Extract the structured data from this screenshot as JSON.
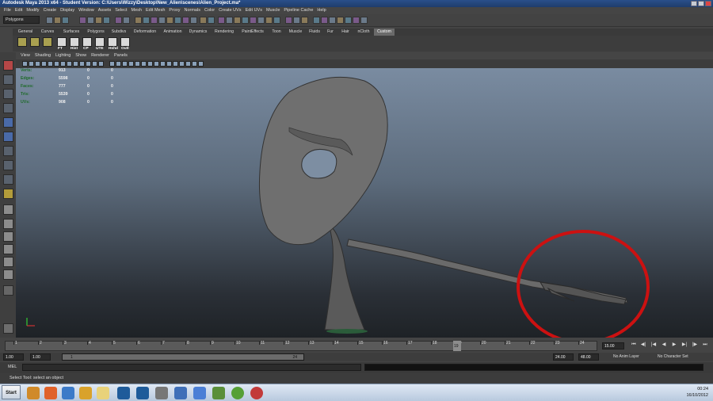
{
  "window": {
    "title": "Autodesk Maya 2013 x64 - Student Version: C:\\Users\\Wizzy\\Desktop\\New_Alien\\scenes\\Alien_Project.ma*"
  },
  "menubar": [
    "File",
    "Edit",
    "Modify",
    "Create",
    "Display",
    "Window",
    "Assets",
    "Select",
    "Mesh",
    "Edit Mesh",
    "Proxy",
    "Normals",
    "Color",
    "Create UVs",
    "Edit UVs",
    "Muscle",
    "Pipeline Cache",
    "Help"
  ],
  "status_line": {
    "mode": "Polygons"
  },
  "shelf_tabs": [
    {
      "label": "General",
      "active": false
    },
    {
      "label": "Curves",
      "active": false
    },
    {
      "label": "Surfaces",
      "active": false
    },
    {
      "label": "Polygons",
      "active": false
    },
    {
      "label": "Subdivs",
      "active": false
    },
    {
      "label": "Deformation",
      "active": false
    },
    {
      "label": "Animation",
      "active": false
    },
    {
      "label": "Dynamics",
      "active": false
    },
    {
      "label": "Rendering",
      "active": false
    },
    {
      "label": "PaintEffects",
      "active": false
    },
    {
      "label": "Toon",
      "active": false
    },
    {
      "label": "Muscle",
      "active": false
    },
    {
      "label": "Fluids",
      "active": false
    },
    {
      "label": "Fur",
      "active": false
    },
    {
      "label": "Hair",
      "active": false
    },
    {
      "label": "nCloth",
      "active": false
    },
    {
      "label": "Custom",
      "active": true
    }
  ],
  "shelf_buttons": [
    "FT",
    "Hist",
    "CP",
    "UTE",
    "Hshd",
    "Outl"
  ],
  "viewport": {
    "menu": [
      "View",
      "Shading",
      "Lighting",
      "Show",
      "Renderer",
      "Panels"
    ],
    "hud": [
      {
        "label": "Verts:",
        "v1": "913",
        "v2": "0",
        "v3": "0"
      },
      {
        "label": "Edges:",
        "v1": "5598",
        "v2": "0",
        "v3": "0"
      },
      {
        "label": "Faces:",
        "v1": "777",
        "v2": "0",
        "v3": "0"
      },
      {
        "label": "Tris:",
        "v1": "5539",
        "v2": "0",
        "v3": "0"
      },
      {
        "label": "UVs:",
        "v1": "908",
        "v2": "0",
        "v3": "0"
      }
    ],
    "annotation_color": "#cc1111"
  },
  "timeline": {
    "ticks": [
      "1",
      "2",
      "3",
      "4",
      "5",
      "6",
      "7",
      "8",
      "9",
      "10",
      "11",
      "12",
      "13",
      "14",
      "15",
      "16",
      "17",
      "18",
      "19",
      "20",
      "21",
      "22",
      "23",
      "24"
    ],
    "current_time": "15.00",
    "current_marker": "19"
  },
  "range": {
    "start": "1.00",
    "start2": "1.00",
    "slider_start": "1",
    "slider_end": "24",
    "end": "24.00",
    "end2": "48.00",
    "anim_layer": "No Anim Layer",
    "char_set": "No Character Set"
  },
  "command_line": {
    "label": "MEL"
  },
  "help_line": {
    "text": "Select Tool: select an object"
  },
  "taskbar": {
    "start_label": "Start",
    "clock_time": "00:24",
    "clock_date": "16/10/2012"
  }
}
